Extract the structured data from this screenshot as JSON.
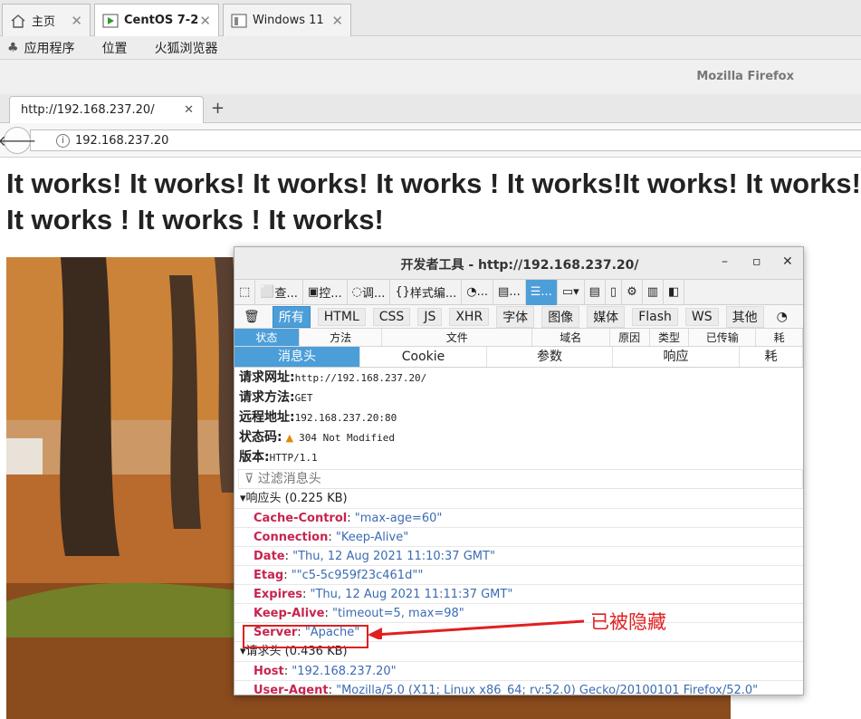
{
  "vm_tabs": [
    {
      "label": "主页"
    },
    {
      "label": "CentOS 7-2"
    },
    {
      "label": "Windows 11"
    }
  ],
  "gnome_menu": {
    "apps": "应用程序",
    "places": "位置",
    "browser": "火狐浏览器"
  },
  "firefox": {
    "window_title": "Mozilla Firefox",
    "tab_title": "http://192.168.237.20/",
    "url": "192.168.237.20",
    "page_headline": "It works! It works! It works! It works ! It works!It works! It works! It works ! It works ! It works!"
  },
  "devtools": {
    "title": "开发者工具 - http://192.168.237.20/",
    "toolbar": [
      "查...",
      "控...",
      "调...",
      "样式编...",
      "...",
      "...",
      "..."
    ],
    "filters": [
      "所有",
      "HTML",
      "CSS",
      "JS",
      "XHR",
      "字体",
      "图像",
      "媒体",
      "Flash",
      "WS",
      "其他"
    ],
    "columns": [
      "状态",
      "方法",
      "文件",
      "域名",
      "原因",
      "类型",
      "已传输",
      "耗"
    ],
    "subtabs": [
      "消息头",
      "Cookie",
      "参数",
      "响应",
      "耗"
    ],
    "summary": {
      "url_label": "请求网址:",
      "url": "http://192.168.237.20/",
      "method_label": "请求方法:",
      "method": "GET",
      "remote_label": "远程地址:",
      "remote": "192.168.237.20:80",
      "status_label": "状态码:",
      "status": "304 Not Modified",
      "version_label": "版本:",
      "version": "HTTP/1.1"
    },
    "filter_placeholder": "过滤消息头",
    "response_headers_title": "响应头 (0.225 KB)",
    "response_headers": [
      {
        "k": "Cache-Control",
        "v": "\"max-age=60\""
      },
      {
        "k": "Connection",
        "v": "\"Keep-Alive\""
      },
      {
        "k": "Date",
        "v": "\"Thu, 12 Aug 2021 11:10:37 GMT\""
      },
      {
        "k": "Etag",
        "v": "\"\"c5-5c959f23c461d\"\""
      },
      {
        "k": "Expires",
        "v": "\"Thu, 12 Aug 2021 11:11:37 GMT\""
      },
      {
        "k": "Keep-Alive",
        "v": "\"timeout=5, max=98\""
      },
      {
        "k": "Server",
        "v": "\"Apache\""
      }
    ],
    "request_headers_title": "请求头 (0.436 KB)",
    "request_headers": [
      {
        "k": "Host",
        "v": "\"192.168.237.20\""
      },
      {
        "k": "User-Agent",
        "v": "\"Mozilla/5.0 (X11; Linux x86_64; rv:52.0) Gecko/20100101 Firefox/52.0\""
      }
    ]
  },
  "annotation": "已被隐藏",
  "colors": {
    "accent": "#4c9ed9",
    "header_key": "#c7254e",
    "header_value": "#3b6bb3",
    "annotation": "#e02020"
  }
}
